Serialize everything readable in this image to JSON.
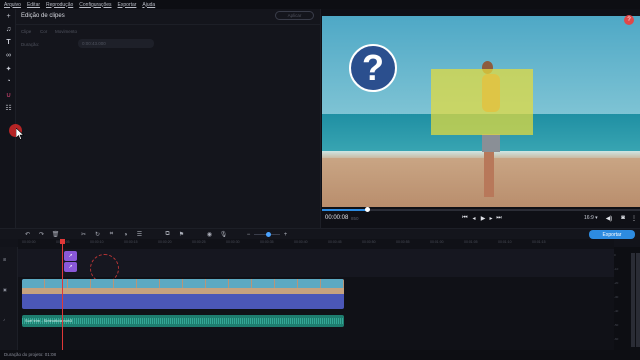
{
  "menu": [
    "Arquivo",
    "Editar",
    "Reprodução",
    "Configurações",
    "Exportar",
    "Ajuda"
  ],
  "panel": {
    "title": "Edição de clipes",
    "apply_label": "Aplicar",
    "tabs": [
      "Clipe",
      "Cor",
      "Movimento"
    ],
    "duration_label": "Duração:",
    "duration_value": "0:00:43.000"
  },
  "player": {
    "overlay_glyph": "?",
    "timecode": "00:00:08",
    "timecode_frames": "850",
    "progress_fraction": 0.14,
    "aspect_ratio": "16:9 ▾",
    "close_glyph": "?"
  },
  "timeline": {
    "export_label": "Exportar",
    "ruler_ticks": [
      "00:00:00",
      "00:00:05",
      "00:00:10",
      "00:00:15",
      "00:00:20",
      "00:00:25",
      "00:00:30",
      "00:00:35",
      "00:00:40",
      "00:00:45",
      "00:00:50",
      "00:00:55",
      "00:01:00",
      "00:01:05",
      "00:01:10",
      "00:01:15"
    ],
    "audio_clip_label": "Surf trim - Sintnoticia noh3",
    "fx_glyph": "↗"
  },
  "meter": {
    "labels": [
      "0",
      "-10",
      "-20",
      "-30",
      "-40",
      "-50",
      "-60"
    ]
  },
  "status": {
    "duration_text": "Duração do projeto: 01:08"
  },
  "colors": {
    "accent": "#2d8be0",
    "playhead": "#e03838",
    "highlight": "#e6dc3c",
    "fx_chip": "#8a58d8"
  }
}
